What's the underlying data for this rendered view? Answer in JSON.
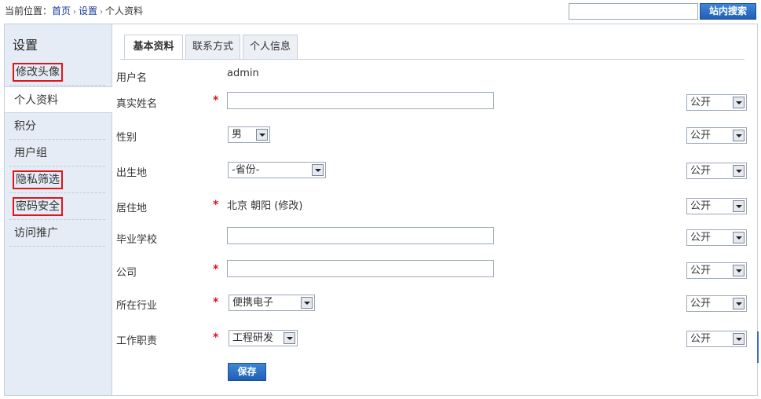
{
  "breadcrumb": {
    "prefix": "当前位置：",
    "home": "首页",
    "settings": "设置",
    "current": "个人资料"
  },
  "search": {
    "placeholder": "",
    "button": "站内搜索"
  },
  "sidebar": {
    "title": "设置",
    "items": [
      {
        "label": "修改头像",
        "boxed": true
      },
      {
        "label": "个人资料",
        "active": true
      },
      {
        "label": "积分"
      },
      {
        "label": "用户组"
      },
      {
        "label": "隐私筛选",
        "boxed": true
      },
      {
        "label": "密码安全",
        "boxed": true
      },
      {
        "label": "访问推广"
      }
    ]
  },
  "tabs": [
    "基本资料",
    "联系方式",
    "个人信息"
  ],
  "form": {
    "username": {
      "label": "用户名",
      "value": "admin"
    },
    "realname": {
      "label": "真实姓名",
      "value": ""
    },
    "gender": {
      "label": "性别",
      "value": "男"
    },
    "birthplace": {
      "label": "出生地",
      "value": "-省份-"
    },
    "residence": {
      "label": "居住地",
      "value": "北京 朝阳 (修改)"
    },
    "school": {
      "label": "毕业学校",
      "value": ""
    },
    "company": {
      "label": "公司",
      "value": ""
    },
    "industry": {
      "label": "所在行业",
      "value": "便携电子"
    },
    "position": {
      "label": "工作职责",
      "value": "工程研发"
    },
    "privacy": "公开",
    "required_mark": "*",
    "save": "保存"
  },
  "colors": {
    "accent": "#1f5fb5",
    "required": "#e0141c",
    "sidebar_bg": "#e5ecf5",
    "highlight_box": "#e0141c"
  }
}
